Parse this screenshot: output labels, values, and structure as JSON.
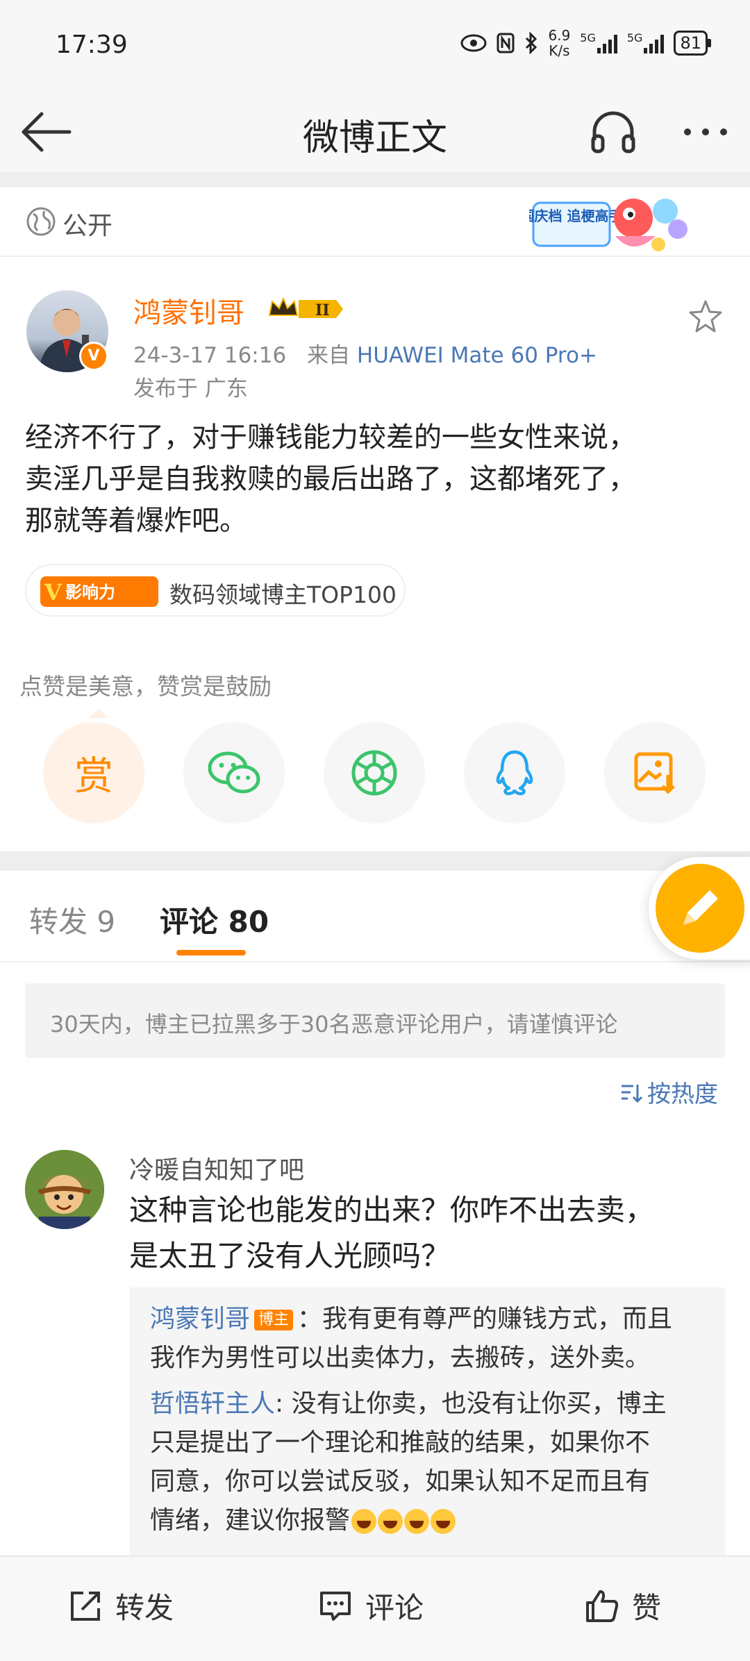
{
  "status_bar": {
    "time": "17:39",
    "net_speed_value": "6.9",
    "net_speed_unit": "K/s",
    "sig1_label": "5G",
    "sig2_label": "5G",
    "battery": "81"
  },
  "nav": {
    "title": "微博正文"
  },
  "post": {
    "visibility": "公开",
    "author": "鸿蒙钊哥",
    "vip_level": "II",
    "date": "24-3-17 16:16",
    "source_prefix": "来自",
    "device": "HUAWEI Mate 60 Pro+",
    "location": "发布于 广东",
    "lines": [
      "经济不行了，对于赚钱能力较差的一些女性来说，",
      "卖淫几乎是自我救赎的最后出路了，这都堵死了，",
      "那就等着爆炸吧。"
    ],
    "influence_logo": "影响力",
    "influence_text": "数码领域博主TOP100",
    "activity_badge": "国庆档 追梗高手"
  },
  "reward": {
    "hint": "点赞是美意，赞赏是鼓励",
    "button_char": "赏"
  },
  "tabs": {
    "repost_label": "转发 9",
    "comment_label": "评论 80"
  },
  "notice": "30天内，博主已拉黑多于30名恶意评论用户，请谨慎评论",
  "sort_label": "按热度",
  "comment": {
    "user": "冷暖自知知了吧",
    "lines": [
      "这种言论也能发的出来？你咋不出去卖，",
      "是太丑了没有人光顾吗？"
    ],
    "replies": [
      {
        "user": "鸿蒙钊哥",
        "badge": "博主",
        "line1": "：我有更有尊严的赚钱方式，而且",
        "line2": "我作为男性可以出卖体力，去搬砖，送外卖。"
      },
      {
        "user": "哲悟轩主人",
        "line1": ": 没有让你卖，也没有让你买，博主",
        "line2": "只是提出了一个理论和推敲的结果，如果你不",
        "line3": "同意，你可以尝试反驳，如果认知不足而且有",
        "line4": "情绪，建议你报警"
      }
    ]
  },
  "bottom_bar": {
    "repost": "转发",
    "comment": "评论",
    "like": "赞"
  },
  "colors": {
    "accent": "#ff8200",
    "link": "#4a78b5"
  }
}
